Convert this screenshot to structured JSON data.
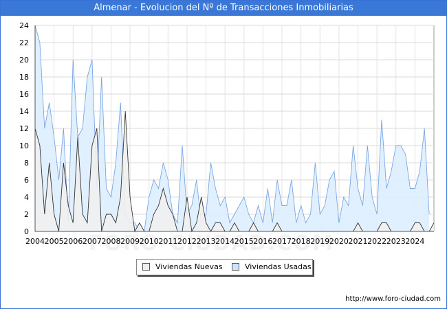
{
  "title": "Almenar - Evolucion del Nº de Transacciones Inmobiliarias",
  "footer": "http://www.foro-ciudad.com",
  "watermark": "FORO-CIUDAD.COM",
  "colors": {
    "title_bg": "#3a78d8",
    "nuevas_fill": "#f0f0f0",
    "nuevas_line": "#333333",
    "usadas_fill": "#deeeff",
    "usadas_line": "#7aa6e6"
  },
  "chart_data": {
    "type": "area",
    "title": "Almenar - Evolucion del Nº de Transacciones Inmobiliarias",
    "x_unit": "quarter",
    "x_start": "2004 Q1",
    "x_end": "2024 Q4",
    "xticks": [
      "2004",
      "2005",
      "2006",
      "2007",
      "2008",
      "2009",
      "2010",
      "2011",
      "2012",
      "2013",
      "2014",
      "2015",
      "2016",
      "2017",
      "2018",
      "2019",
      "2020",
      "2021",
      "2022",
      "2023",
      "2024"
    ],
    "yticks": [
      0,
      2,
      4,
      6,
      8,
      10,
      12,
      14,
      16,
      18,
      20,
      22,
      24
    ],
    "ylim": [
      0,
      24
    ],
    "grid": true,
    "legend_position": "bottom",
    "series": [
      {
        "name": "Viviendas Nuevas",
        "values": [
          12,
          10,
          2,
          8,
          2,
          0,
          8,
          3,
          1,
          11,
          2,
          1,
          10,
          12,
          0,
          2,
          2,
          1,
          4,
          14,
          4,
          0,
          1,
          0,
          0,
          2,
          3,
          5,
          3,
          2,
          0,
          0,
          4,
          0,
          1,
          4,
          1,
          0,
          1,
          1,
          0,
          0,
          1,
          0,
          0,
          0,
          1,
          0,
          0,
          0,
          0,
          1,
          0,
          0,
          0,
          0,
          0,
          0,
          0,
          0,
          0,
          0,
          0,
          0,
          0,
          0,
          0,
          0,
          1,
          0,
          0,
          0,
          0,
          1,
          1,
          0,
          0,
          0,
          0,
          0,
          1,
          1,
          0,
          0,
          1
        ]
      },
      {
        "name": "Viviendas Usadas",
        "values": [
          24,
          22,
          12,
          15,
          11,
          6,
          12,
          1,
          20,
          11,
          12,
          18,
          20,
          5,
          18,
          5,
          4,
          8,
          15,
          2,
          1,
          1,
          0,
          0,
          4,
          6,
          5,
          8,
          6,
          2,
          1,
          10,
          2,
          3,
          6,
          1,
          2,
          8,
          5,
          3,
          4,
          1,
          2,
          3,
          4,
          2,
          1,
          3,
          1,
          5,
          1,
          6,
          3,
          3,
          6,
          1,
          3,
          1,
          2,
          8,
          2,
          3,
          6,
          7,
          1,
          4,
          3,
          10,
          5,
          3,
          10,
          4,
          2,
          13,
          5,
          7,
          10,
          10,
          9,
          5,
          5,
          7,
          12,
          2
        ]
      }
    ]
  },
  "legend": {
    "nuevas_label": "Viviendas Nuevas",
    "usadas_label": "Viviendas Usadas"
  }
}
